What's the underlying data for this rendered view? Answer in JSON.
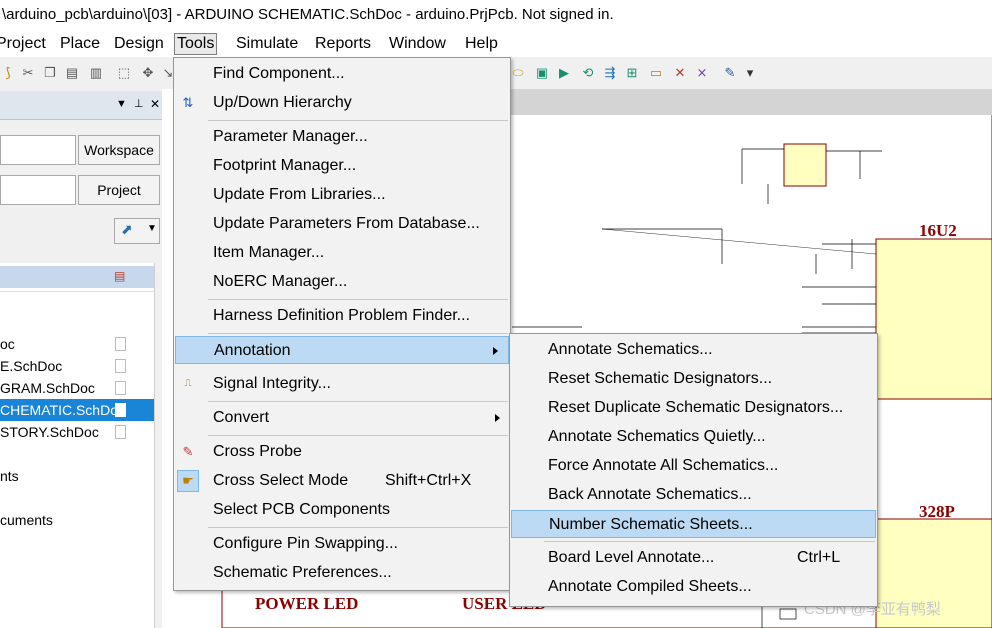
{
  "title_bar": "\\arduino_pcb\\arduino\\[03] - ARDUINO SCHEMATIC.SchDoc - arduino.PrjPcb. Not signed in.",
  "menubar": [
    {
      "label": "Project"
    },
    {
      "label": "Place"
    },
    {
      "label": "Design"
    },
    {
      "label": "Tools"
    },
    {
      "label": "Simulate"
    },
    {
      "label": "Reports"
    },
    {
      "label": "Window"
    },
    {
      "label": "Help"
    }
  ],
  "left_panel": {
    "workspace_button": "Workspace",
    "project_button": "Project",
    "files": [
      {
        "label": "oc"
      },
      {
        "label": "E.SchDoc"
      },
      {
        "label": "GRAM.SchDoc"
      },
      {
        "label": "CHEMATIC.SchDoc"
      },
      {
        "label": "STORY.SchDoc"
      },
      {
        "label": ""
      },
      {
        "label": "nts"
      },
      {
        "label": ""
      },
      {
        "label": "cuments"
      }
    ]
  },
  "tools_menu": {
    "items": [
      {
        "label": "Find Component...",
        "icon": "blank"
      },
      {
        "label": "Up/Down Hierarchy",
        "icon": "up-down-arrows-icon"
      },
      {
        "label": "Parameter Manager...",
        "icon": "blank"
      },
      {
        "label": "Footprint Manager...",
        "icon": "blank"
      },
      {
        "label": "Update From Libraries...",
        "icon": "blank"
      },
      {
        "label": "Update Parameters From Database...",
        "icon": "blank"
      },
      {
        "label": "Item Manager...",
        "icon": "blank"
      },
      {
        "label": "NoERC Manager...",
        "icon": "blank"
      },
      {
        "label": "Harness Definition Problem Finder...",
        "icon": "blank"
      },
      {
        "label": "Annotation",
        "icon": "blank"
      },
      {
        "label": "Signal Integrity...",
        "icon": "signal-integrity-icon"
      },
      {
        "label": "Convert",
        "icon": "blank"
      },
      {
        "label": "Cross Probe",
        "icon": "cross-probe-icon"
      },
      {
        "label": "Cross Select Mode",
        "shortcut": "Shift+Ctrl+X",
        "icon": "cross-select-icon"
      },
      {
        "label": "Select PCB Components",
        "icon": "blank"
      },
      {
        "label": "Configure Pin Swapping...",
        "icon": "blank"
      },
      {
        "label": "Schematic Preferences...",
        "icon": "blank"
      }
    ]
  },
  "annotation_submenu": {
    "items": [
      {
        "label": "Annotate Schematics..."
      },
      {
        "label": "Reset Schematic Designators..."
      },
      {
        "label": "Reset Duplicate Schematic Designators..."
      },
      {
        "label": "Annotate Schematics Quietly..."
      },
      {
        "label": "Force Annotate All Schematics..."
      },
      {
        "label": "Back Annotate Schematics..."
      },
      {
        "label": "Number Schematic Sheets..."
      },
      {
        "label": "Board Level Annotate...",
        "shortcut": "Ctrl+L"
      },
      {
        "label": "Annotate Compiled Sheets..."
      }
    ]
  },
  "schematic": {
    "labels": [
      "16U2",
      "328P",
      "POWER LED",
      "USER LED"
    ],
    "watermark": "CSDN @李亚有鸭梨"
  },
  "colors": {
    "highlight": "#bcdaf4",
    "selected_file": "#1a84d6",
    "schematic_label": "#8b0000"
  }
}
